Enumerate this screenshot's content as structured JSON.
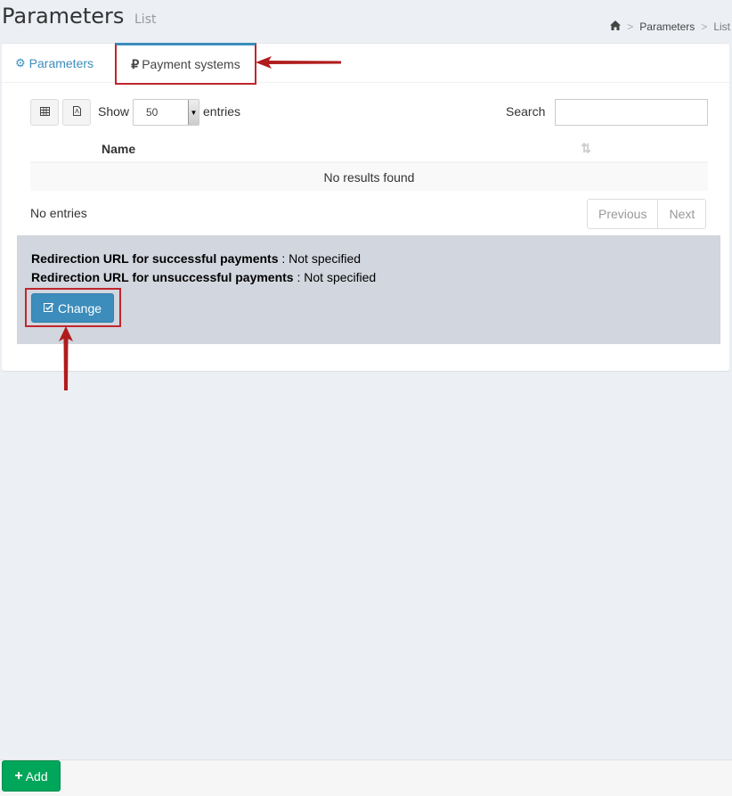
{
  "header": {
    "title": "Parameters",
    "subtitle": "List",
    "breadcrumb": [
      "Parameters",
      "List"
    ]
  },
  "tabs": [
    {
      "label": "Parameters",
      "icon": "gear-icon"
    },
    {
      "label": "Payment systems",
      "icon": "ruble-icon"
    }
  ],
  "toolbar": {
    "show_label": "Show",
    "page_size": "50",
    "entries_label": "entries",
    "search_label": "Search",
    "search_value": ""
  },
  "table": {
    "columns": [
      "Name"
    ],
    "empty_message": "No results found"
  },
  "info": {
    "count_text": "No entries",
    "previous": "Previous",
    "next": "Next"
  },
  "redirect": {
    "success_label": "Redirection URL for successful payments",
    "success_value": ": Not specified",
    "fail_label": "Redirection URL for unsuccessful payments",
    "fail_value": ": Not specified",
    "change_label": "Change"
  },
  "footer": {
    "add_label": "Add"
  },
  "colors": {
    "accent": "#3c8dbc",
    "highlight": "#c0262d",
    "add": "#00a65a"
  }
}
